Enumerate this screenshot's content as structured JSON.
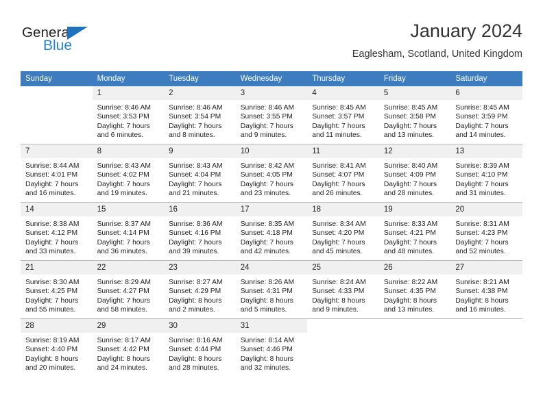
{
  "brand": {
    "name_top": "General",
    "name_bottom": "Blue",
    "accent_color": "#1f72bd",
    "logo_blue": "#2585d3"
  },
  "header": {
    "title": "January 2024",
    "subtitle": "Eaglesham, Scotland, United Kingdom",
    "header_bg": "#3c7cbf",
    "daynum_bg": "#f0f0f0"
  },
  "weekdays": [
    "Sunday",
    "Monday",
    "Tuesday",
    "Wednesday",
    "Thursday",
    "Friday",
    "Saturday"
  ],
  "weeks": [
    [
      {
        "day": "",
        "blank": true,
        "sunrise": "",
        "sunset": "",
        "daylight1": "",
        "daylight2": ""
      },
      {
        "day": "1",
        "sunrise": "Sunrise: 8:46 AM",
        "sunset": "Sunset: 3:53 PM",
        "daylight1": "Daylight: 7 hours",
        "daylight2": "and 6 minutes."
      },
      {
        "day": "2",
        "sunrise": "Sunrise: 8:46 AM",
        "sunset": "Sunset: 3:54 PM",
        "daylight1": "Daylight: 7 hours",
        "daylight2": "and 8 minutes."
      },
      {
        "day": "3",
        "sunrise": "Sunrise: 8:46 AM",
        "sunset": "Sunset: 3:55 PM",
        "daylight1": "Daylight: 7 hours",
        "daylight2": "and 9 minutes."
      },
      {
        "day": "4",
        "sunrise": "Sunrise: 8:45 AM",
        "sunset": "Sunset: 3:57 PM",
        "daylight1": "Daylight: 7 hours",
        "daylight2": "and 11 minutes."
      },
      {
        "day": "5",
        "sunrise": "Sunrise: 8:45 AM",
        "sunset": "Sunset: 3:58 PM",
        "daylight1": "Daylight: 7 hours",
        "daylight2": "and 13 minutes."
      },
      {
        "day": "6",
        "sunrise": "Sunrise: 8:45 AM",
        "sunset": "Sunset: 3:59 PM",
        "daylight1": "Daylight: 7 hours",
        "daylight2": "and 14 minutes."
      }
    ],
    [
      {
        "day": "7",
        "sunrise": "Sunrise: 8:44 AM",
        "sunset": "Sunset: 4:01 PM",
        "daylight1": "Daylight: 7 hours",
        "daylight2": "and 16 minutes."
      },
      {
        "day": "8",
        "sunrise": "Sunrise: 8:43 AM",
        "sunset": "Sunset: 4:02 PM",
        "daylight1": "Daylight: 7 hours",
        "daylight2": "and 19 minutes."
      },
      {
        "day": "9",
        "sunrise": "Sunrise: 8:43 AM",
        "sunset": "Sunset: 4:04 PM",
        "daylight1": "Daylight: 7 hours",
        "daylight2": "and 21 minutes."
      },
      {
        "day": "10",
        "sunrise": "Sunrise: 8:42 AM",
        "sunset": "Sunset: 4:05 PM",
        "daylight1": "Daylight: 7 hours",
        "daylight2": "and 23 minutes."
      },
      {
        "day": "11",
        "sunrise": "Sunrise: 8:41 AM",
        "sunset": "Sunset: 4:07 PM",
        "daylight1": "Daylight: 7 hours",
        "daylight2": "and 26 minutes."
      },
      {
        "day": "12",
        "sunrise": "Sunrise: 8:40 AM",
        "sunset": "Sunset: 4:09 PM",
        "daylight1": "Daylight: 7 hours",
        "daylight2": "and 28 minutes."
      },
      {
        "day": "13",
        "sunrise": "Sunrise: 8:39 AM",
        "sunset": "Sunset: 4:10 PM",
        "daylight1": "Daylight: 7 hours",
        "daylight2": "and 31 minutes."
      }
    ],
    [
      {
        "day": "14",
        "sunrise": "Sunrise: 8:38 AM",
        "sunset": "Sunset: 4:12 PM",
        "daylight1": "Daylight: 7 hours",
        "daylight2": "and 33 minutes."
      },
      {
        "day": "15",
        "sunrise": "Sunrise: 8:37 AM",
        "sunset": "Sunset: 4:14 PM",
        "daylight1": "Daylight: 7 hours",
        "daylight2": "and 36 minutes."
      },
      {
        "day": "16",
        "sunrise": "Sunrise: 8:36 AM",
        "sunset": "Sunset: 4:16 PM",
        "daylight1": "Daylight: 7 hours",
        "daylight2": "and 39 minutes."
      },
      {
        "day": "17",
        "sunrise": "Sunrise: 8:35 AM",
        "sunset": "Sunset: 4:18 PM",
        "daylight1": "Daylight: 7 hours",
        "daylight2": "and 42 minutes."
      },
      {
        "day": "18",
        "sunrise": "Sunrise: 8:34 AM",
        "sunset": "Sunset: 4:20 PM",
        "daylight1": "Daylight: 7 hours",
        "daylight2": "and 45 minutes."
      },
      {
        "day": "19",
        "sunrise": "Sunrise: 8:33 AM",
        "sunset": "Sunset: 4:21 PM",
        "daylight1": "Daylight: 7 hours",
        "daylight2": "and 48 minutes."
      },
      {
        "day": "20",
        "sunrise": "Sunrise: 8:31 AM",
        "sunset": "Sunset: 4:23 PM",
        "daylight1": "Daylight: 7 hours",
        "daylight2": "and 52 minutes."
      }
    ],
    [
      {
        "day": "21",
        "sunrise": "Sunrise: 8:30 AM",
        "sunset": "Sunset: 4:25 PM",
        "daylight1": "Daylight: 7 hours",
        "daylight2": "and 55 minutes."
      },
      {
        "day": "22",
        "sunrise": "Sunrise: 8:29 AM",
        "sunset": "Sunset: 4:27 PM",
        "daylight1": "Daylight: 7 hours",
        "daylight2": "and 58 minutes."
      },
      {
        "day": "23",
        "sunrise": "Sunrise: 8:27 AM",
        "sunset": "Sunset: 4:29 PM",
        "daylight1": "Daylight: 8 hours",
        "daylight2": "and 2 minutes."
      },
      {
        "day": "24",
        "sunrise": "Sunrise: 8:26 AM",
        "sunset": "Sunset: 4:31 PM",
        "daylight1": "Daylight: 8 hours",
        "daylight2": "and 5 minutes."
      },
      {
        "day": "25",
        "sunrise": "Sunrise: 8:24 AM",
        "sunset": "Sunset: 4:33 PM",
        "daylight1": "Daylight: 8 hours",
        "daylight2": "and 9 minutes."
      },
      {
        "day": "26",
        "sunrise": "Sunrise: 8:22 AM",
        "sunset": "Sunset: 4:35 PM",
        "daylight1": "Daylight: 8 hours",
        "daylight2": "and 13 minutes."
      },
      {
        "day": "27",
        "sunrise": "Sunrise: 8:21 AM",
        "sunset": "Sunset: 4:38 PM",
        "daylight1": "Daylight: 8 hours",
        "daylight2": "and 16 minutes."
      }
    ],
    [
      {
        "day": "28",
        "sunrise": "Sunrise: 8:19 AM",
        "sunset": "Sunset: 4:40 PM",
        "daylight1": "Daylight: 8 hours",
        "daylight2": "and 20 minutes."
      },
      {
        "day": "29",
        "sunrise": "Sunrise: 8:17 AM",
        "sunset": "Sunset: 4:42 PM",
        "daylight1": "Daylight: 8 hours",
        "daylight2": "and 24 minutes."
      },
      {
        "day": "30",
        "sunrise": "Sunrise: 8:16 AM",
        "sunset": "Sunset: 4:44 PM",
        "daylight1": "Daylight: 8 hours",
        "daylight2": "and 28 minutes."
      },
      {
        "day": "31",
        "sunrise": "Sunrise: 8:14 AM",
        "sunset": "Sunset: 4:46 PM",
        "daylight1": "Daylight: 8 hours",
        "daylight2": "and 32 minutes."
      },
      {
        "day": "",
        "blank": true,
        "sunrise": "",
        "sunset": "",
        "daylight1": "",
        "daylight2": ""
      },
      {
        "day": "",
        "blank": true,
        "sunrise": "",
        "sunset": "",
        "daylight1": "",
        "daylight2": ""
      },
      {
        "day": "",
        "blank": true,
        "sunrise": "",
        "sunset": "",
        "daylight1": "",
        "daylight2": ""
      }
    ]
  ]
}
